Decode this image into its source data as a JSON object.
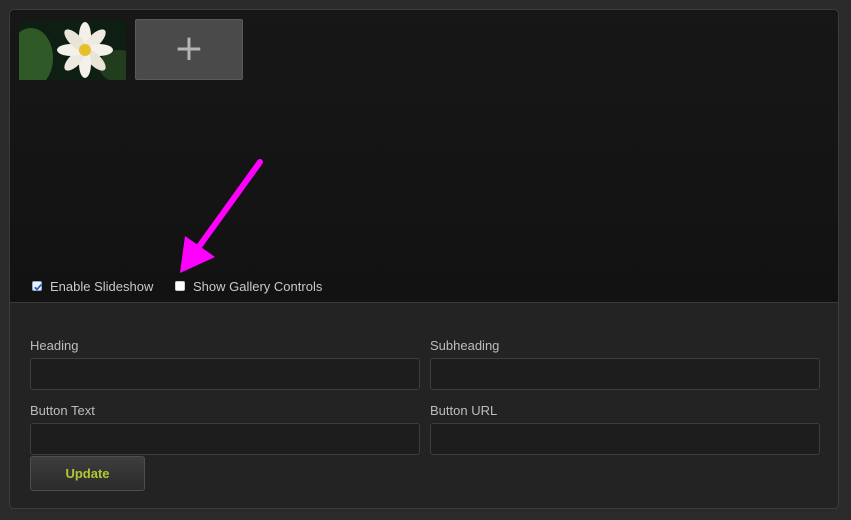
{
  "gallery": {
    "add_tile_symbol": "+",
    "thumbnail_icon": "water-lily-image",
    "options": [
      {
        "label": "Enable Slideshow",
        "checked": true
      },
      {
        "label": "Show Gallery Controls",
        "checked": false
      }
    ],
    "annotation_arrow_color": "#ff00ff"
  },
  "form": {
    "heading_label": "Heading",
    "subheading_label": "Subheading",
    "button_text_label": "Button Text",
    "button_url_label": "Button URL",
    "heading_value": "",
    "subheading_value": "",
    "button_text_value": "",
    "button_url_value": "",
    "update_label": "Update"
  },
  "colors": {
    "panel_bg": "#232323",
    "gallery_bg": "#141414",
    "update_text": "#b5c733"
  }
}
